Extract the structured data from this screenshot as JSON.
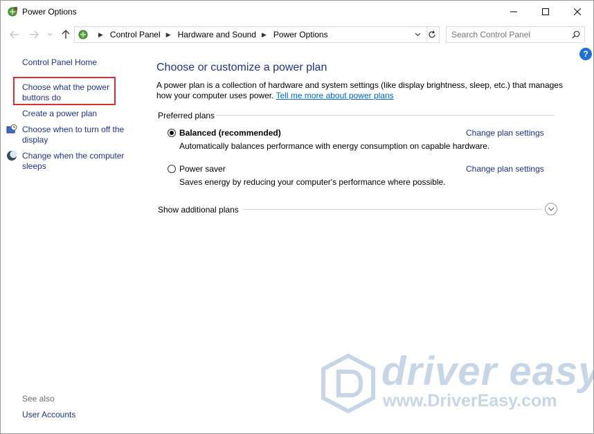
{
  "window": {
    "title": "Power Options"
  },
  "address": {
    "crumbs": [
      "Control Panel",
      "Hardware and Sound",
      "Power Options"
    ]
  },
  "search": {
    "placeholder": "Search Control Panel"
  },
  "left_pane": {
    "home": "Control Panel Home",
    "links": [
      {
        "label": "Choose what the power buttons do"
      },
      {
        "label": "Create a power plan"
      },
      {
        "label": "Choose when to turn off the display",
        "icon": "display-clock-icon"
      },
      {
        "label": "Change when the computer sleeps",
        "icon": "moon-icon"
      }
    ],
    "see_also": "See also",
    "user_accounts": "User Accounts"
  },
  "main": {
    "title": "Choose or customize a power plan",
    "description": "A power plan is a collection of hardware and system settings (like display brightness, sleep, etc.) that manages how your computer uses power.",
    "tell_more": "Tell me more about power plans",
    "preferred_label": "Preferred plans",
    "plans": [
      {
        "name": "Balanced (recommended)",
        "selected": true,
        "desc": "Automatically balances performance with energy consumption on capable hardware.",
        "link": "Change plan settings"
      },
      {
        "name": "Power saver",
        "selected": false,
        "desc": "Saves energy by reducing your computer's performance where possible.",
        "link": "Change plan settings"
      }
    ],
    "show_additional": "Show additional plans"
  },
  "help": {
    "label": "?"
  },
  "watermark": {
    "brand": "driver easy",
    "url": "www.DriverEasy.com"
  },
  "colors": {
    "link": "#1e3287",
    "highlight_box": "#d9302c",
    "help_blue": "#1e6fd9"
  }
}
